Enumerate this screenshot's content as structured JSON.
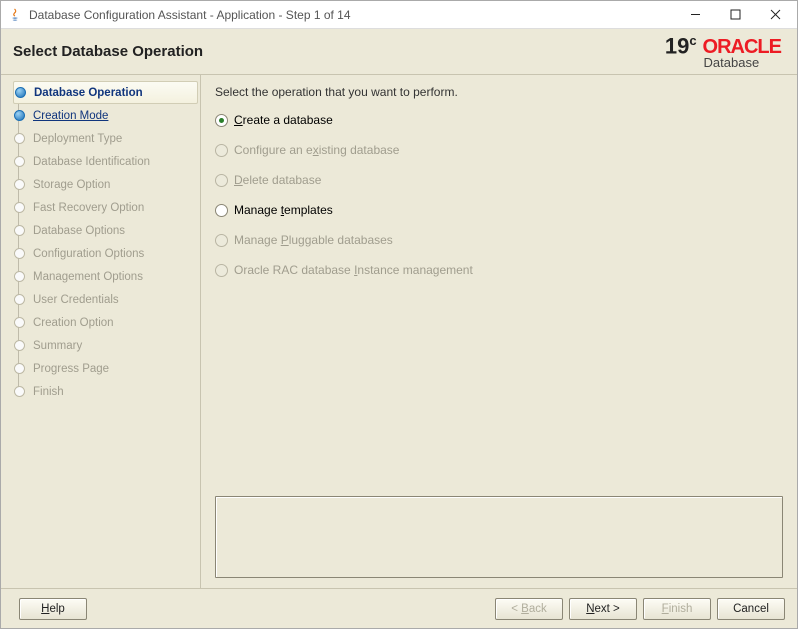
{
  "window": {
    "title": "Database Configuration Assistant - Application - Step 1 of 14"
  },
  "header": {
    "page_title": "Select Database Operation",
    "brand_version": "19",
    "brand_version_sup": "c",
    "brand_name": "ORACLE",
    "brand_sub": "Database"
  },
  "sidebar": {
    "steps": [
      {
        "label": "Database Operation",
        "state": "current"
      },
      {
        "label": "Creation Mode",
        "state": "link"
      },
      {
        "label": "Deployment Type",
        "state": "disabled"
      },
      {
        "label": "Database Identification",
        "state": "disabled"
      },
      {
        "label": "Storage Option",
        "state": "disabled"
      },
      {
        "label": "Fast Recovery Option",
        "state": "disabled"
      },
      {
        "label": "Database Options",
        "state": "disabled"
      },
      {
        "label": "Configuration Options",
        "state": "disabled"
      },
      {
        "label": "Management Options",
        "state": "disabled"
      },
      {
        "label": "User Credentials",
        "state": "disabled"
      },
      {
        "label": "Creation Option",
        "state": "disabled"
      },
      {
        "label": "Summary",
        "state": "disabled"
      },
      {
        "label": "Progress Page",
        "state": "disabled"
      },
      {
        "label": "Finish",
        "state": "disabled"
      }
    ]
  },
  "content": {
    "instruction": "Select the operation that you want to perform.",
    "options": [
      {
        "before": "",
        "mn": "C",
        "after": "reate a database",
        "enabled": true,
        "selected": true
      },
      {
        "before": "Configure an e",
        "mn": "x",
        "after": "isting database",
        "enabled": false,
        "selected": false
      },
      {
        "before": "",
        "mn": "D",
        "after": "elete database",
        "enabled": false,
        "selected": false
      },
      {
        "before": "Manage ",
        "mn": "t",
        "after": "emplates",
        "enabled": true,
        "selected": false
      },
      {
        "before": "Manage ",
        "mn": "P",
        "after": "luggable databases",
        "enabled": false,
        "selected": false
      },
      {
        "before": "Oracle RAC database ",
        "mn": "I",
        "after": "nstance management",
        "enabled": false,
        "selected": false
      }
    ]
  },
  "footer": {
    "help_mn": "H",
    "help_after": "elp",
    "back_before": "< ",
    "back_mn": "B",
    "back_after": "ack",
    "next_mn": "N",
    "next_after": "ext >",
    "finish_mn": "F",
    "finish_after": "inish",
    "cancel": "Cancel"
  }
}
